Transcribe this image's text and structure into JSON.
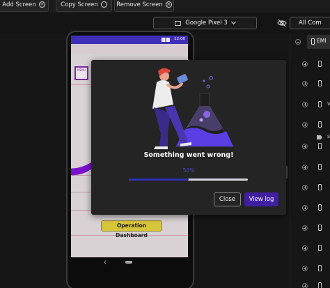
{
  "toolbar": {
    "add_screen": "Add Screen",
    "copy_screen": "Copy Screen",
    "remove_screen": "Remove Screen",
    "add_icon": "plus-circle-icon",
    "copy_icon": "copy-toggle-icon",
    "remove_icon": "x-circle-icon"
  },
  "device_selector": {
    "label": "Google Pixel 3",
    "icon": "tablet-phone-icon"
  },
  "all_components": {
    "label": "All Com"
  },
  "phone": {
    "time": "12:00",
    "button_label": "Operation Dashboard",
    "menu_icon_label": "MENU"
  },
  "modal": {
    "message": "Something went wrong!",
    "progress_label": "50%",
    "progress_value": 0.5,
    "close_label": "Close",
    "view_log_label": "View log"
  },
  "right_panel": {
    "top_item": "EMI",
    "rows": [
      {
        "text": ""
      },
      {
        "text": ""
      },
      {
        "text": "v"
      },
      {
        "text": "s"
      },
      {
        "text": ""
      },
      {
        "text": ""
      },
      {
        "text": ""
      },
      {
        "text": ""
      },
      {
        "text": ""
      },
      {
        "text": ""
      },
      {
        "text": ""
      },
      {
        "text": ""
      },
      {
        "text": ""
      }
    ]
  },
  "colors": {
    "accent_purple": "#3f1fa0",
    "progress_blue": "#2f2fb2",
    "badge_yellow": "#d7c53a",
    "status_bar": "#3f2fb8"
  }
}
